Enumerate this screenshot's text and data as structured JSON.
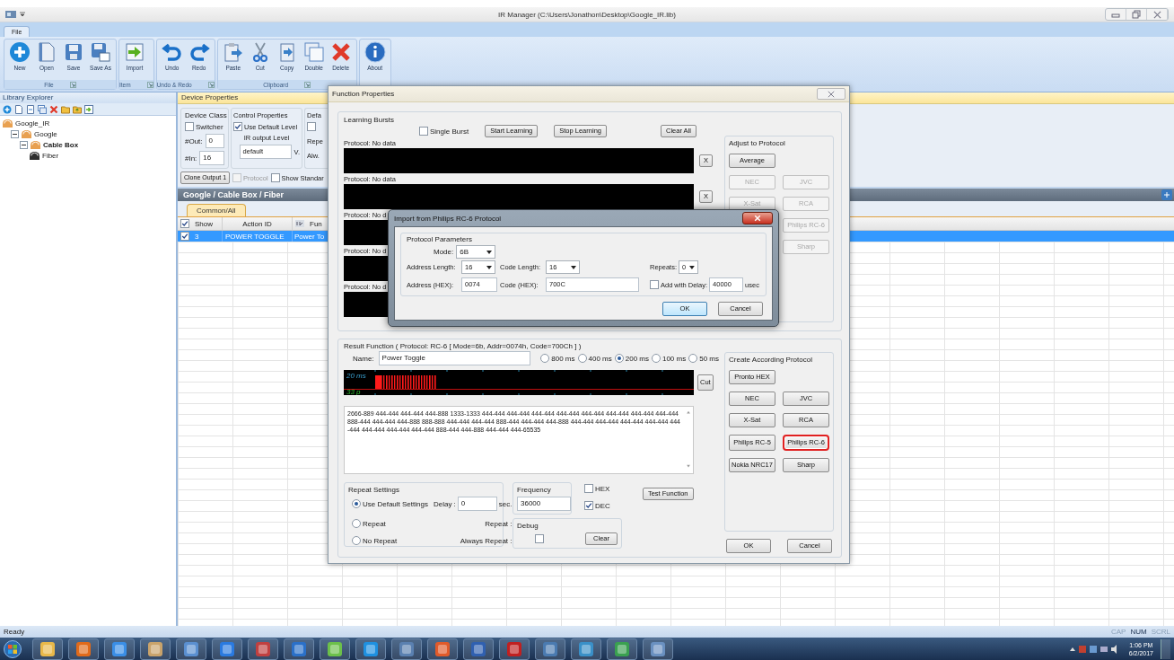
{
  "window": {
    "title": "IR Manager (C:\\Users\\Jonathon\\Desktop\\Google_IR.lib)"
  },
  "ribbon": {
    "tabs": [
      {
        "label": "File",
        "selected": true
      }
    ],
    "groups": [
      {
        "label": "File",
        "buttons": [
          {
            "label": "New"
          },
          {
            "label": "Open"
          },
          {
            "label": "Save"
          },
          {
            "label": "Save As"
          }
        ]
      },
      {
        "label": "Item",
        "buttons": [
          {
            "label": "Import"
          }
        ]
      },
      {
        "label": "Undo & Redo",
        "buttons": [
          {
            "label": "Undo"
          },
          {
            "label": "Redo"
          }
        ]
      },
      {
        "label": "Clipboard",
        "buttons": [
          {
            "label": "Paste"
          },
          {
            "label": "Cut"
          },
          {
            "label": "Copy"
          },
          {
            "label": "Double"
          },
          {
            "label": "Delete"
          }
        ]
      },
      {
        "buttons": [
          {
            "label": "About"
          }
        ]
      }
    ]
  },
  "library_explorer": {
    "title": "Library Explorer",
    "tree": [
      {
        "label": "Google_IR",
        "selected": false,
        "children": [
          {
            "label": "Google",
            "selected": false,
            "expanded": true,
            "children": [
              {
                "label": "Cable Box",
                "selected": true,
                "expanded": true,
                "children": [
                  {
                    "label": "Fiber",
                    "selected": false
                  }
                ]
              }
            ]
          }
        ]
      }
    ]
  },
  "device_properties": {
    "title": "Device Properties",
    "device_class": {
      "label": "Device Class",
      "switcher": {
        "label": "Switcher",
        "checked": false
      },
      "out_label": "#Out:",
      "out_value": "0",
      "in_label": "#In:",
      "in_value": "16"
    },
    "control_properties": {
      "label": "Control Properties",
      "use_default": {
        "label": "Use Default Level",
        "checked": true
      },
      "ir_label": "IR output Level",
      "ir_value": "default",
      "unit": "V."
    },
    "column_3": {
      "label": "Defa",
      "checkbox": {
        "checked": false
      },
      "text_1": "Repe",
      "text_2": "Alw."
    },
    "clone_button": "Clone Output 1",
    "protocol": {
      "label": "Protocol",
      "checked": false,
      "disabled": true
    },
    "show_standard": {
      "label": "Show Standar",
      "checked": false,
      "disabled": false
    }
  },
  "breadcrumb": "Google / Cable Box / Fiber",
  "function_tabs": [
    {
      "label": "Common/All",
      "selected": true
    }
  ],
  "table": {
    "header_checked": true,
    "columns": [
      "Show",
      "Action ID",
      "Fun"
    ],
    "rows": [
      {
        "checked": true,
        "show": "3",
        "action_id": "POWER TOGGLE",
        "function": "Power To",
        "selected": true
      }
    ]
  },
  "status_bar": {
    "text": "Ready",
    "indicators": [
      {
        "label": "CAP",
        "on": false
      },
      {
        "label": "NUM",
        "on": true
      },
      {
        "label": "SCRL",
        "on": false
      }
    ]
  },
  "taskbar": {
    "time": "1:06 PM",
    "date": "6/2/2017"
  },
  "function_properties": {
    "title": "Function Properties",
    "learning": {
      "label": "Learning Bursts",
      "single_burst": {
        "label": "Single Burst",
        "checked": false
      },
      "buttons": [
        "Start Learning",
        "Stop Learning",
        "Clear All"
      ],
      "bursts": [
        {
          "label": "Protocol: No data",
          "clear": "X"
        },
        {
          "label": "Protocol: No data",
          "clear": "X"
        },
        {
          "label": "Protocol: No d"
        },
        {
          "label": "Protocol: No d"
        },
        {
          "label": "Protocol: No d"
        }
      ]
    },
    "adjust": {
      "label": "Adjust to Protocol",
      "buttons": [
        {
          "label": "Average",
          "disabled": false
        },
        {
          "label": "NEC",
          "disabled": true
        },
        {
          "label": "JVC",
          "disabled": true
        },
        {
          "label": "X-Sat",
          "disabled": true
        },
        {
          "label": "RCA",
          "disabled": true
        },
        {
          "label": "Philips RC-6",
          "disabled": true
        },
        {
          "label": "Sharp",
          "disabled": true
        }
      ]
    },
    "result": {
      "label": "Result Function ( Protocol: RC-6 [ Mode=6b, Addr=0074h, Code=700Ch ] )",
      "name_label": "Name:",
      "name_value": "Power Toggle",
      "durations": [
        {
          "label": "800 ms",
          "selected": false
        },
        {
          "label": "400 ms",
          "selected": false
        },
        {
          "label": "200 ms",
          "selected": true
        },
        {
          "label": "100 ms",
          "selected": false
        },
        {
          "label": "50 ms",
          "selected": false
        }
      ],
      "scale_top": "20 ms",
      "scale_bottom": "33 p",
      "cut": "Cut",
      "code": "2666-889 444-444 444-444 444-888 1333-1333 444-444 444-444 444-444 444-444 444-444 444-444 444-444 444-444 888-444 444-444 444-888 888-888 444-444 444-444 888-444 444-444 444-888 444-444 444-444 444-444 444-444 444-444 444-444 444-444 444-444 888-444 444-888 444-444 444-65535",
      "repeat": {
        "label": "Repeat Settings",
        "options": [
          {
            "label": "Use Default Settings",
            "selected": true
          },
          {
            "label": "Repeat",
            "selected": false
          },
          {
            "label": "No Repeat",
            "selected": false
          }
        ],
        "delay_label": "Delay :",
        "delay_value": "0",
        "delay_unit": "sec.",
        "repeat_label": "Repeat :",
        "always_label": "Always Repeat :"
      },
      "frequency": {
        "label": "Frequency",
        "value": "36000"
      },
      "hex": {
        "label": "HEX",
        "checked": false
      },
      "dec": {
        "label": "DEC",
        "checked": true
      },
      "test": "Test Function",
      "debug": {
        "label": "Debug",
        "checked": false,
        "clear": "Clear"
      }
    },
    "create": {
      "label": "Create According Protocol",
      "buttons": [
        {
          "label": "Pronto HEX",
          "highlighted": false
        },
        {
          "label": "NEC",
          "highlighted": false
        },
        {
          "label": "JVC",
          "highlighted": false
        },
        {
          "label": "X-Sat",
          "highlighted": false
        },
        {
          "label": "RCA",
          "highlighted": false
        },
        {
          "label": "Philips RC-5",
          "highlighted": false
        },
        {
          "label": "Philips RC-6",
          "highlighted": true
        },
        {
          "label": "Nokia NRC17",
          "highlighted": false
        },
        {
          "label": "Sharp",
          "highlighted": false
        }
      ]
    },
    "ok": "OK",
    "cancel": "Cancel"
  },
  "import_dialog": {
    "title": "Import from Philips RC-6 Protocol",
    "group": "Protocol Parameters",
    "mode": {
      "label": "Mode:",
      "value": "6B"
    },
    "address_length": {
      "label": "Address Length:",
      "value": "16"
    },
    "code_length": {
      "label": "Code Length:",
      "value": "16"
    },
    "repeats": {
      "label": "Repeats:",
      "value": "0"
    },
    "address": {
      "label": "Address (HEX):",
      "value": "0074"
    },
    "code": {
      "label": "Code (HEX):",
      "value": "700C"
    },
    "add_delay": {
      "label": "Add",
      "checked": false,
      "delay_label": "with Delay:",
      "value": "40000",
      "unit": "usec"
    },
    "ok": "OK",
    "cancel": "Cancel"
  }
}
